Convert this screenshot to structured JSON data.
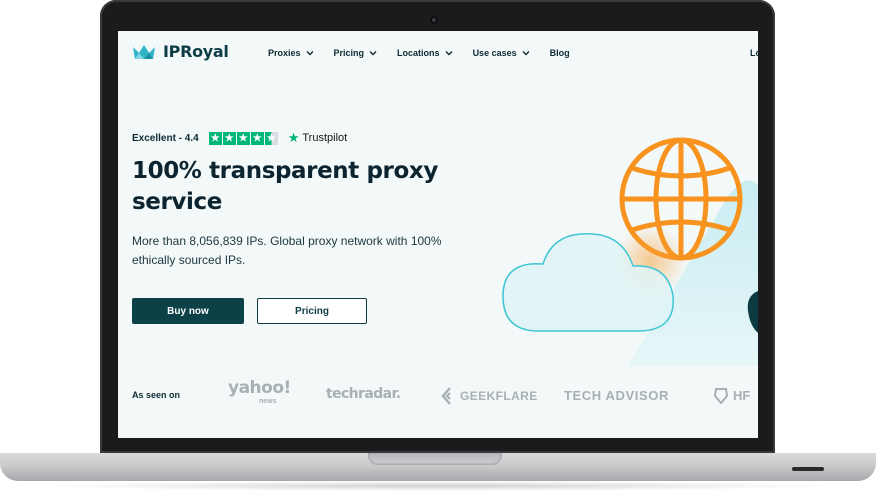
{
  "brand": {
    "name": "IPRoyal",
    "logo_icon": "crown-icon",
    "accent": "#0b4147",
    "globe_color": "#f7931e",
    "trustpilot_green": "#00b67a"
  },
  "nav": {
    "items": [
      {
        "label": "Proxies",
        "icon": "chevron-down-icon"
      },
      {
        "label": "Pricing",
        "icon": "chevron-down-icon"
      },
      {
        "label": "Locations",
        "icon": "chevron-down-icon"
      },
      {
        "label": "Use cases",
        "icon": "chevron-down-icon"
      },
      {
        "label": "Blog"
      }
    ],
    "login_partial": "Lo"
  },
  "hero": {
    "rating_label": "Excellent - 4.4",
    "rating_value": 4.4,
    "rating_max": 5,
    "trustpilot_label": "Trustpilot",
    "headline": "100% transparent proxy service",
    "subtext": "More than 8,056,839 IPs. Global proxy network with 100% ethically sourced IPs.",
    "primary_button": "Buy now",
    "secondary_button": "Pricing"
  },
  "press": {
    "label": "As seen on",
    "logos": {
      "yahoo": "yahoo!",
      "yahoo_sub": "news",
      "techradar": "techradar.",
      "geekflare": "GEEKFLARE",
      "techadvisor": "TECH ADVISOR",
      "hf": "HF"
    }
  }
}
